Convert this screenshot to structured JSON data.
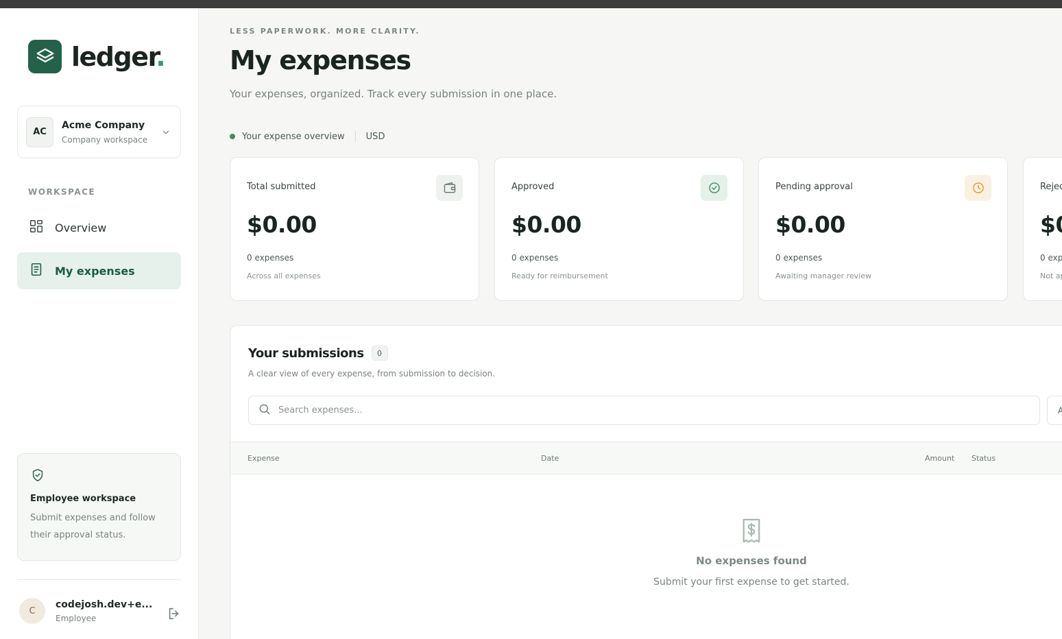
{
  "app": {
    "name": "ledger",
    "name_dot": "."
  },
  "workspace": {
    "initials": "AC",
    "name": "Acme Company",
    "subtitle": "Company workspace"
  },
  "sidebar": {
    "section_label": "WORKSPACE",
    "items": [
      {
        "label": "Overview",
        "icon": "grid-icon",
        "active": false
      },
      {
        "label": "My expenses",
        "icon": "receipt-icon",
        "active": true
      }
    ],
    "info_card": {
      "icon": "shield-check-icon",
      "title": "Employee workspace",
      "text": "Submit expenses and follow their approval status."
    },
    "user": {
      "initial": "C",
      "name": "codejosh.dev+e...",
      "role": "Employee"
    }
  },
  "header": {
    "eyebrow": "LESS PAPERWORK. MORE CLARITY.",
    "title": "My expenses",
    "subtitle": "Your expenses, organized. Track every submission in one place."
  },
  "overview": {
    "label": "Your expense overview",
    "currency": "USD"
  },
  "stats": [
    {
      "label": "Total submitted",
      "value": "$0.00",
      "count": "0 expenses",
      "note": "Across all expenses",
      "icon": "wallet-icon"
    },
    {
      "label": "Approved",
      "value": "$0.00",
      "count": "0 expenses",
      "note": "Ready for reimbursement",
      "icon": "check-circle-icon"
    },
    {
      "label": "Pending approval",
      "value": "$0.00",
      "count": "0 expenses",
      "note": "Awaiting manager review",
      "icon": "clock-icon"
    },
    {
      "label": "Rejec",
      "value": "$0",
      "count": "0 exp",
      "note": "Not ap",
      "icon": ""
    }
  ],
  "submissions": {
    "title": "Your submissions",
    "count": "0",
    "description": "A clear view of every expense, from submission to decision.",
    "search_placeholder": "Search expenses...",
    "filter_label": "A",
    "columns": {
      "expense": "Expense",
      "date": "Date",
      "amount": "Amount",
      "status": "Status"
    },
    "empty": {
      "icon": "receipt-dollar-icon",
      "title": "No expenses found",
      "subtitle": "Submit your first expense to get started."
    }
  },
  "colors": {
    "brand": "#23614a",
    "active_bg": "#e7f1ec",
    "success": "#3f8c63",
    "pending": "#d59a3c"
  }
}
